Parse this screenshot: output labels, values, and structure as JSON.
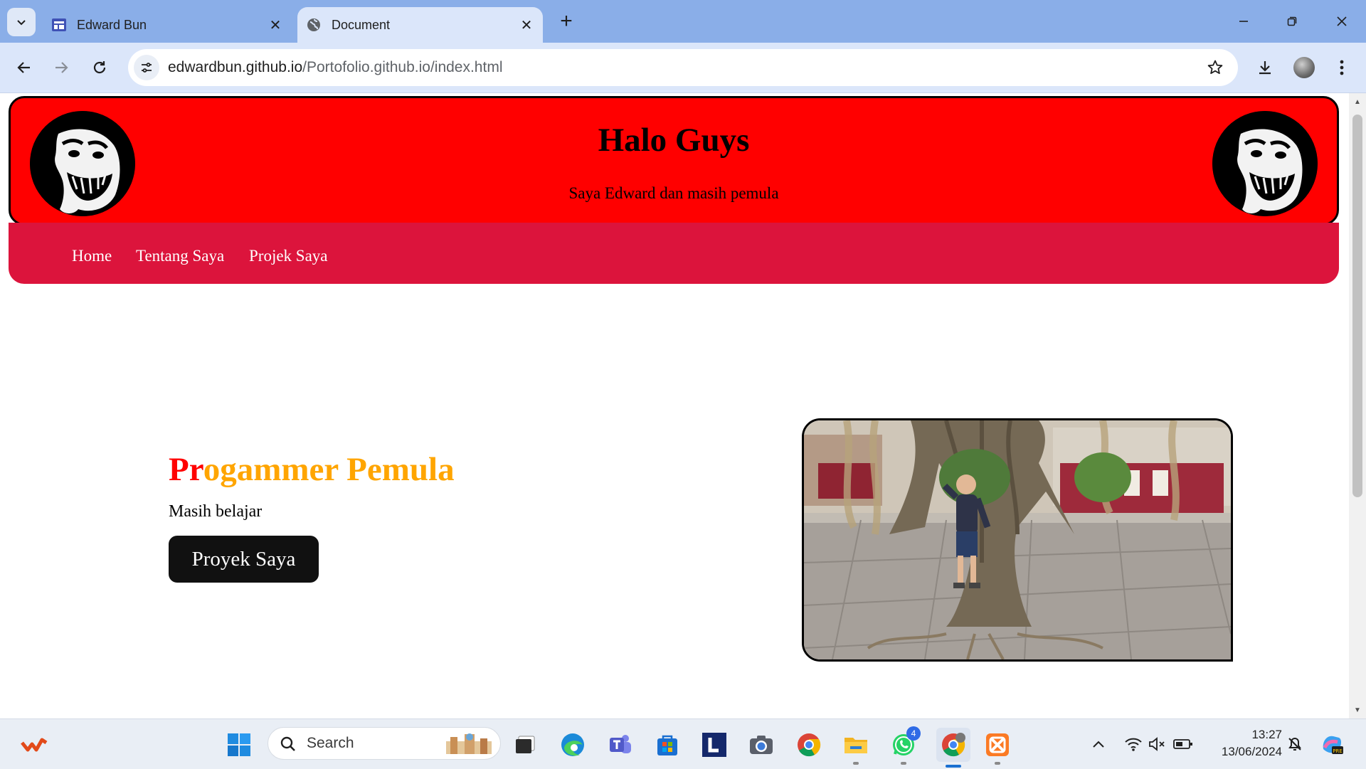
{
  "browser": {
    "tabs": [
      {
        "title": "Edward Bun",
        "active": false
      },
      {
        "title": "Document",
        "active": true
      }
    ],
    "url_domain": "edwardbun.github.io",
    "url_path": "/Portofolio.github.io/index.html",
    "icons": [
      "tab-list-icon",
      "site-favicon",
      "globe-icon",
      "close-icon",
      "new-tab-icon",
      "minimize-icon",
      "restore-icon",
      "back-icon",
      "forward-icon",
      "reload-icon",
      "site-info-icon",
      "bookmark-star-icon",
      "download-icon",
      "profile-avatar",
      "more-menu-icon"
    ]
  },
  "site": {
    "header_title": "Halo Guys",
    "header_subtitle": "Saya Edward dan masih pemula",
    "nav": [
      "Home",
      "Tentang Saya",
      "Projek Saya"
    ],
    "hero_title_accent": "Pr",
    "hero_title_rest": "ogammer Pemula",
    "hero_text": "Masih belajar",
    "hero_button": "Proyek Saya",
    "colors": {
      "header_bg": "#ff0000",
      "nav_bg": "#dc143c",
      "title_orange": "#ffa500",
      "title_red": "#ff0000",
      "button_bg": "#111111"
    }
  },
  "taskbar": {
    "search_placeholder": "Search",
    "whatsapp_badge": "4",
    "time": "13:27",
    "date": "13/06/2024",
    "apps": [
      "widgets-icon",
      "start-icon",
      "search-icon",
      "task-view-icon",
      "edge-icon",
      "teams-icon",
      "store-icon",
      "l-app-icon",
      "camera-icon",
      "chrome-icon",
      "file-explorer-icon",
      "whatsapp-icon",
      "chrome-profile-icon",
      "xampp-icon"
    ],
    "tray": [
      "chevron-up-icon",
      "wifi-icon",
      "volume-muted-icon",
      "battery-icon",
      "notification-icon",
      "copilot-icon"
    ]
  }
}
